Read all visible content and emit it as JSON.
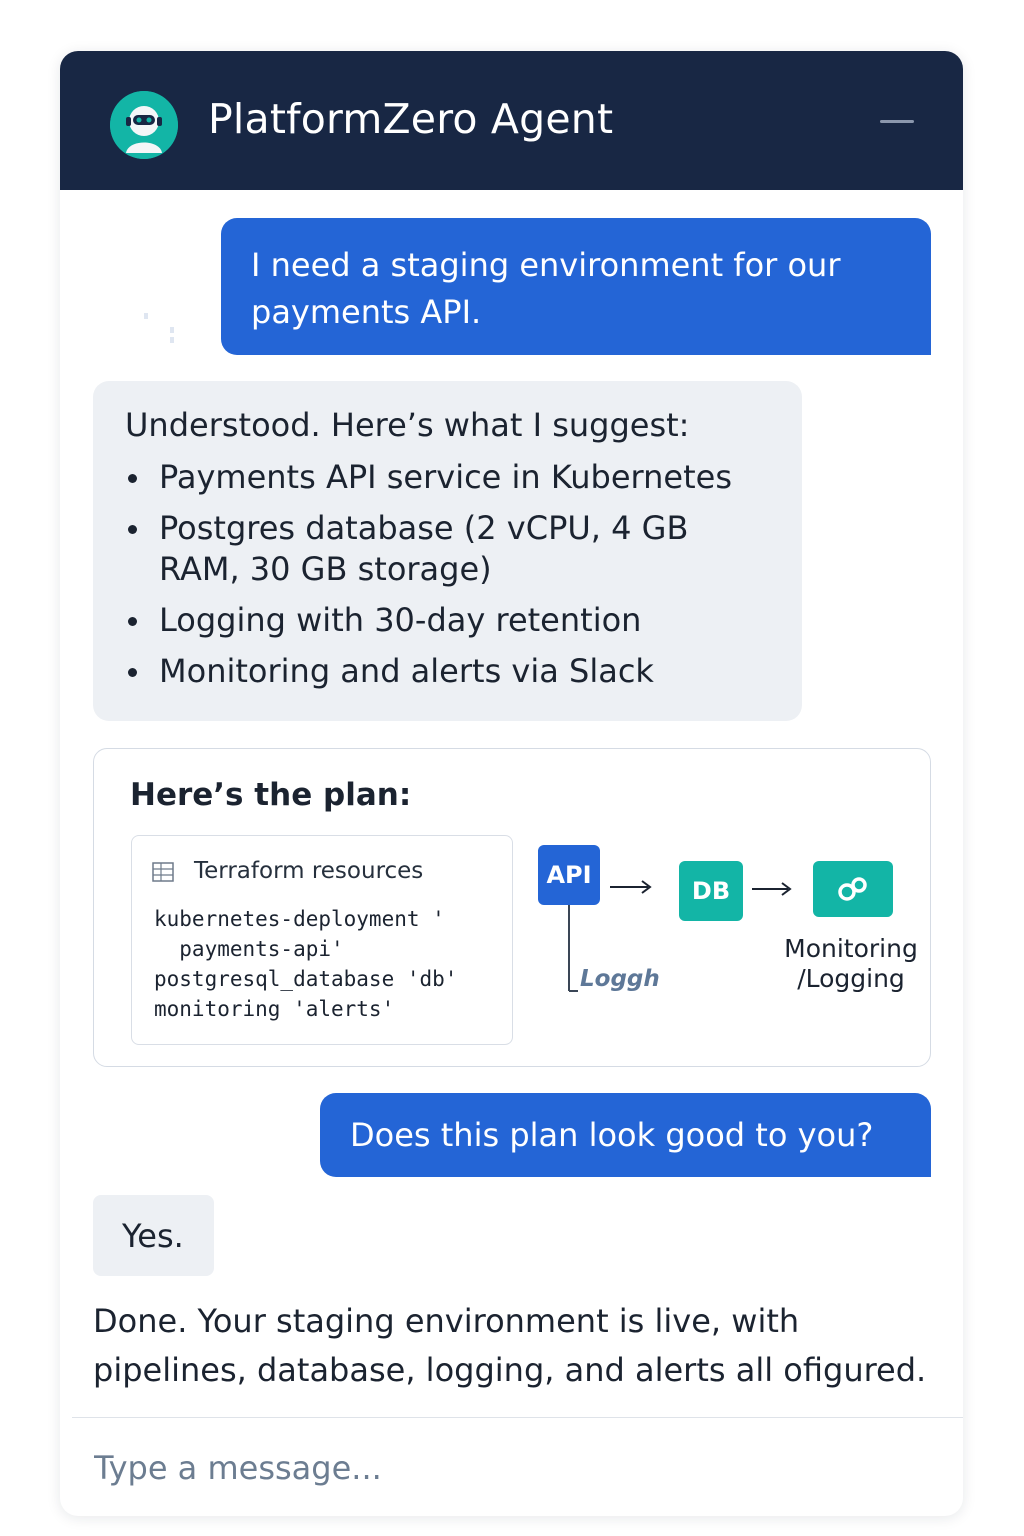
{
  "header": {
    "title": "PlatformZero Agent",
    "avatar_icon": "robot-avatar-icon",
    "minimize_icon": "minimize-icon",
    "colors": {
      "background": "#182744",
      "avatar": "#13b5a6"
    }
  },
  "messages": {
    "user_1": "I need a staging environment for our payments API.",
    "bot_1": {
      "intro": "Understood. Here’s what I suggest:",
      "items": [
        "Payments API service in Kubernetes",
        "Postgres database (2 vCPU, 4 GB RAM, 30 GB storage)",
        "Logging with 30-day retention",
        "Monitoring and alerts via Slack"
      ]
    },
    "plan": {
      "title": "Here’s the plan:",
      "terraform": {
        "title": "Terraform resources",
        "code": "kubernetes-deployment '\n  payments-api'\npostgresql_database 'db'\nmonitoring 'alerts'"
      },
      "diagram": {
        "api": "API",
        "db": "DB",
        "monitoring": "Monitoring\n/Logging",
        "logging": "Loggh"
      }
    },
    "user_2": "Does this plan look good to you?",
    "bot_2": "Yes.",
    "bot_3": "Done. Your staging environment is live, with pipelines, database, logging, and alerts all ofigured."
  },
  "composer": {
    "placeholder": "Type a message..."
  },
  "colors": {
    "user_bubble": "#2465d6",
    "bot_bubble": "#edf0f4",
    "accent_teal": "#13b5a6"
  }
}
